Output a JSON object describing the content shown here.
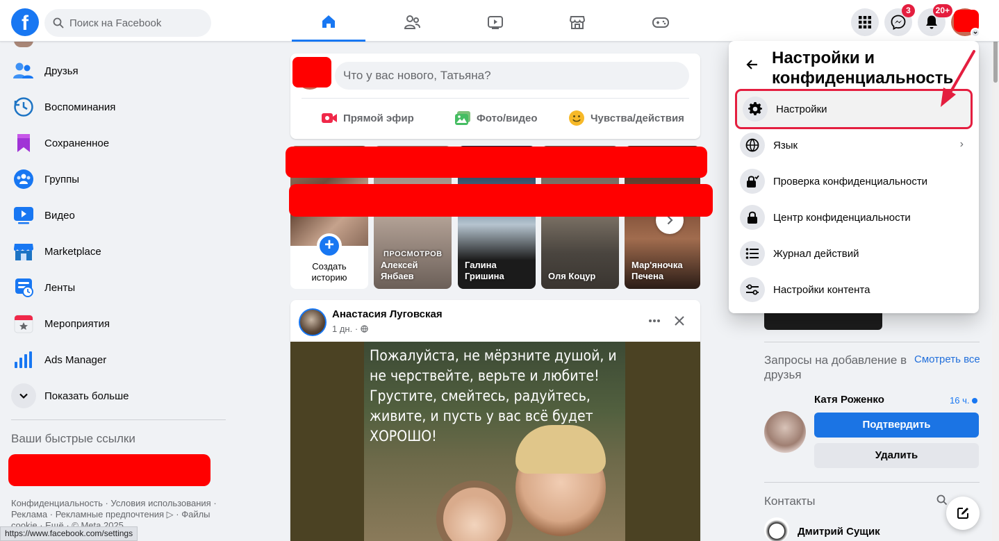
{
  "topbar": {
    "logo": "f",
    "search_placeholder": "Поиск на Facebook",
    "messenger_badge": "3",
    "notifications_badge": "20+"
  },
  "sidebar": {
    "items": [
      {
        "label": "Друзья",
        "icon": "friends-icon"
      },
      {
        "label": "Воспоминания",
        "icon": "memories-icon"
      },
      {
        "label": "Сохраненное",
        "icon": "saved-icon"
      },
      {
        "label": "Группы",
        "icon": "groups-icon"
      },
      {
        "label": "Видео",
        "icon": "video-icon"
      },
      {
        "label": "Marketplace",
        "icon": "marketplace-icon"
      },
      {
        "label": "Ленты",
        "icon": "feeds-icon"
      },
      {
        "label": "Мероприятия",
        "icon": "events-icon"
      },
      {
        "label": "Ads Manager",
        "icon": "ads-manager-icon"
      },
      {
        "label": "Показать больше",
        "icon": "chevron-down-icon"
      }
    ],
    "shortcuts_title": "Ваши быстрые ссылки",
    "footer": "Конфиденциальность · Условия использования · Реклама · Рекламные предпочтения ▷ · Файлы cookie · Ещё · © Meta 2025"
  },
  "status_url": "https://www.facebook.com/settings",
  "composer": {
    "placeholder": "Что у вас нового, Татьяна?",
    "actions": [
      "Прямой эфир",
      "Фото/видео",
      "Чувства/действия"
    ]
  },
  "stories": {
    "create_label_1": "Создать",
    "create_label_2": "историю",
    "items": [
      {
        "name_1": "Алексей",
        "name_2": "Янбаев",
        "overlay": "ПРОСМОТРОВ"
      },
      {
        "name_1": "Галина",
        "name_2": "Гришина",
        "overlay": ""
      },
      {
        "name_1": "Оля Коцур",
        "name_2": "",
        "overlay": ""
      },
      {
        "name_1": "Мар'яночка",
        "name_2": "Печена",
        "overlay": ""
      }
    ]
  },
  "post": {
    "author": "Анастасия Луговская",
    "time": "1 дн. · ",
    "text": "Пожалуйста, не мёрзните душой, и не черствейте, верьте и любите! Грустите, смейтесь, радуйтесь, живите, и пусть у вас всё будет ХОРОШО!"
  },
  "right": {
    "requests_title": "Запросы на добавление в друзья",
    "see_all": "Смотреть все",
    "request_name": "Катя Роженко",
    "request_time": "16 ч.",
    "confirm": "Подтвердить",
    "delete": "Удалить",
    "contacts_title": "Контакты",
    "contact_name": "Дмитрий Сущик"
  },
  "menu": {
    "title": "Настройки и конфиденциальность",
    "items": [
      {
        "label": "Настройки",
        "icon": "gear-icon"
      },
      {
        "label": "Язык",
        "icon": "globe-icon"
      },
      {
        "label": "Проверка конфиденциальности",
        "icon": "lock-check-icon"
      },
      {
        "label": "Центр конфиденциальности",
        "icon": "lock-icon"
      },
      {
        "label": "Журнал действий",
        "icon": "list-icon"
      },
      {
        "label": "Настройки контента",
        "icon": "sliders-icon"
      }
    ]
  },
  "colors": {
    "brand": "#1877f2",
    "redaction": "#ff0000",
    "highlight": "#e41e3f"
  }
}
